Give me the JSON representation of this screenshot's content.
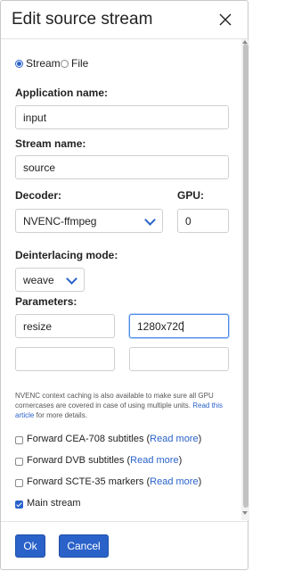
{
  "dialog": {
    "title": "Edit source stream"
  },
  "source_type": {
    "options": [
      {
        "label": "Stream",
        "checked": true
      },
      {
        "label": "File",
        "checked": false
      }
    ]
  },
  "fields": {
    "application_name": {
      "label": "Application name:",
      "value": "input"
    },
    "stream_name": {
      "label": "Stream name:",
      "value": "source"
    },
    "decoder": {
      "label": "Decoder:",
      "value": "NVENC-ffmpeg"
    },
    "gpu": {
      "label": "GPU:",
      "value": "0"
    },
    "deinterlacing": {
      "label": "Deinterlacing mode:",
      "value": "weave"
    },
    "parameters": {
      "label": "Parameters:",
      "rows": [
        {
          "name": "resize",
          "value": "1280x720"
        },
        {
          "name": "",
          "value": ""
        }
      ]
    }
  },
  "note": {
    "text": "NVENC context caching is also available to make sure all GPU cornercases are covered in case of using multiple units.",
    "link": "Read this article",
    "suffix": " for more details."
  },
  "checkboxes": [
    {
      "label": "Forward CEA-708 subtitles (",
      "link": "Read more",
      "close": ")",
      "checked": false
    },
    {
      "label": "Forward DVB subtitles (",
      "link": "Read more",
      "close": ")",
      "checked": false
    },
    {
      "label": "Forward SCTE-35 markers (",
      "link": "Read more",
      "close": ")",
      "checked": false
    },
    {
      "label": "Main stream",
      "link": "",
      "close": "",
      "checked": true
    }
  ],
  "buttons": {
    "ok": "Ok",
    "cancel": "Cancel"
  },
  "colors": {
    "accent": "#2a62c9",
    "border": "#cfcfcf",
    "focus": "#4d8be8"
  },
  "icons": {
    "close": "close-x-icon",
    "select_arrow": "chevron-down-icon"
  }
}
